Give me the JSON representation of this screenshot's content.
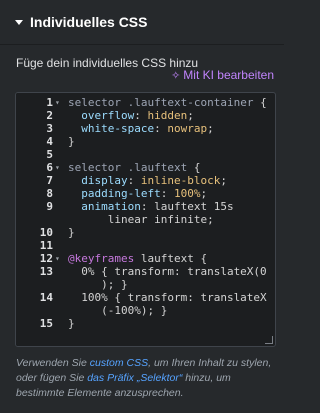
{
  "section": {
    "title": "Individuelles CSS"
  },
  "description": "Füge dein individuelles CSS hinzu",
  "ai_button": {
    "icon": "sparkle-icon",
    "label": "Mit KI bearbeiten"
  },
  "editor": {
    "active_line": 15,
    "lines": [
      {
        "n": "1",
        "fold": true,
        "text": "selector .lauftext-container {"
      },
      {
        "n": "2",
        "fold": false,
        "text": "  overflow: hidden;"
      },
      {
        "n": "3",
        "fold": false,
        "text": "  white-space: nowrap;"
      },
      {
        "n": "4",
        "fold": false,
        "text": "}"
      },
      {
        "n": "5",
        "fold": false,
        "text": ""
      },
      {
        "n": "6",
        "fold": true,
        "text": "selector .lauftext {"
      },
      {
        "n": "7",
        "fold": false,
        "text": "  display: inline-block;"
      },
      {
        "n": "8",
        "fold": false,
        "text": "  padding-left: 100%;"
      },
      {
        "n": "9",
        "fold": false,
        "text": "  animation: lauftext 15s"
      },
      {
        "n": "",
        "fold": false,
        "text": "      linear infinite;"
      },
      {
        "n": "10",
        "fold": false,
        "text": "}"
      },
      {
        "n": "11",
        "fold": false,
        "text": ""
      },
      {
        "n": "12",
        "fold": true,
        "text": "@keyframes lauftext {"
      },
      {
        "n": "13",
        "fold": false,
        "text": "  0% { transform: translateX(0"
      },
      {
        "n": "",
        "fold": false,
        "text": "     ); }"
      },
      {
        "n": "14",
        "fold": false,
        "text": "  100% { transform: translateX"
      },
      {
        "n": "",
        "fold": false,
        "text": "     (-100%); }"
      },
      {
        "n": "15",
        "fold": false,
        "text": "}"
      }
    ]
  },
  "help": {
    "part1": "Verwenden Sie ",
    "link1": "custom CSS",
    "part2": ", um Ihren Inhalt zu stylen, oder fügen Sie ",
    "link2": "das Präfix „Selektor“",
    "part3": " hinzu, um bestimmte Elemente anzusprechen."
  }
}
